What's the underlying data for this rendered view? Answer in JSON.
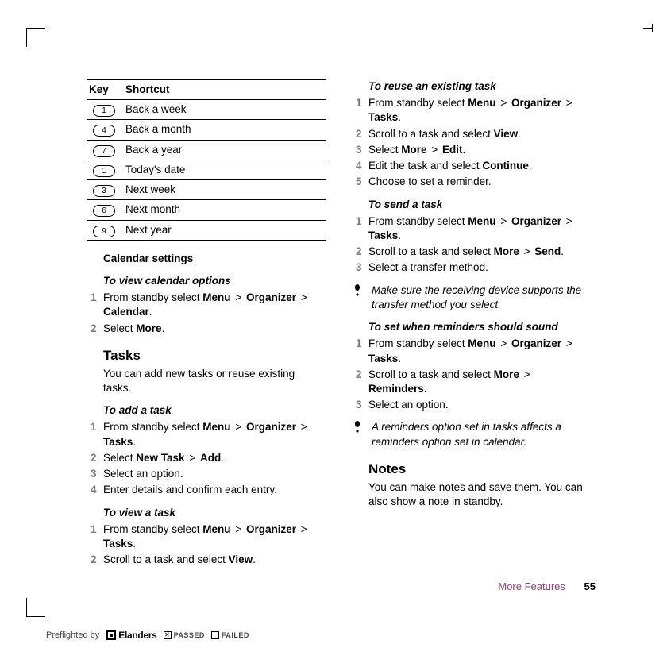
{
  "table": {
    "headers": {
      "key": "Key",
      "shortcut": "Shortcut"
    },
    "rows": [
      {
        "keycap": "1",
        "shortcut": "Back a week"
      },
      {
        "keycap": "4",
        "shortcut": "Back a month"
      },
      {
        "keycap": "7",
        "shortcut": "Back a year"
      },
      {
        "keycap": "C",
        "shortcut": "Today's date"
      },
      {
        "keycap": "3",
        "shortcut": "Next week"
      },
      {
        "keycap": "6",
        "shortcut": "Next month"
      },
      {
        "keycap": "9",
        "shortcut": "Next year"
      }
    ]
  },
  "left": {
    "cal_settings": "Calendar settings",
    "view_cal_options": "To view calendar options",
    "s1_pre": "From standby select ",
    "menu": "Menu",
    "gt": ">",
    "organizer": "Organizer",
    "calendar": "Calendar",
    "dot": ".",
    "s2_pre": "Select ",
    "more": "More",
    "tasks_h": "Tasks",
    "tasks_intro": "You can add new tasks or reuse existing tasks.",
    "add_task": "To add a task",
    "tasks": "Tasks",
    "newtask": "New Task",
    "add": "Add",
    "s3": "Select an option.",
    "s4": "Enter details and confirm each entry.",
    "view_task": "To view a task",
    "view": "View",
    "scroll_select": "Scroll to a task and select "
  },
  "right": {
    "reuse": "To reuse an existing task",
    "from_standby": "From standby select ",
    "menu": "Menu",
    "gt": ">",
    "organizer": "Organizer",
    "tasks": "Tasks",
    "dot": ".",
    "scroll_select": "Scroll to a task and select ",
    "view": "View",
    "select": "Select ",
    "more": "More",
    "edit": "Edit",
    "edit_select": "Edit the task and select ",
    "continue": "Continue",
    "choose_rem": "Choose to set a reminder.",
    "send_task": "To send a task",
    "send": "Send",
    "sel_transfer": "Select a transfer method.",
    "note1": "Make sure the receiving device supports the transfer method you select.",
    "set_rem": "To set when reminders should sound",
    "reminders": "Reminders",
    "sel_option": "Select an option.",
    "note2": "A reminders option set in tasks affects a reminders option set in calendar.",
    "notes_h": "Notes",
    "notes_intro": "You can make notes and save them. You can also show a note in standby."
  },
  "footer": {
    "section": "More Features",
    "page": "55"
  },
  "preflight": {
    "pre": "Preflighted by",
    "brand": "Elanders",
    "passed": "PASSED",
    "failed": "FAILED"
  }
}
